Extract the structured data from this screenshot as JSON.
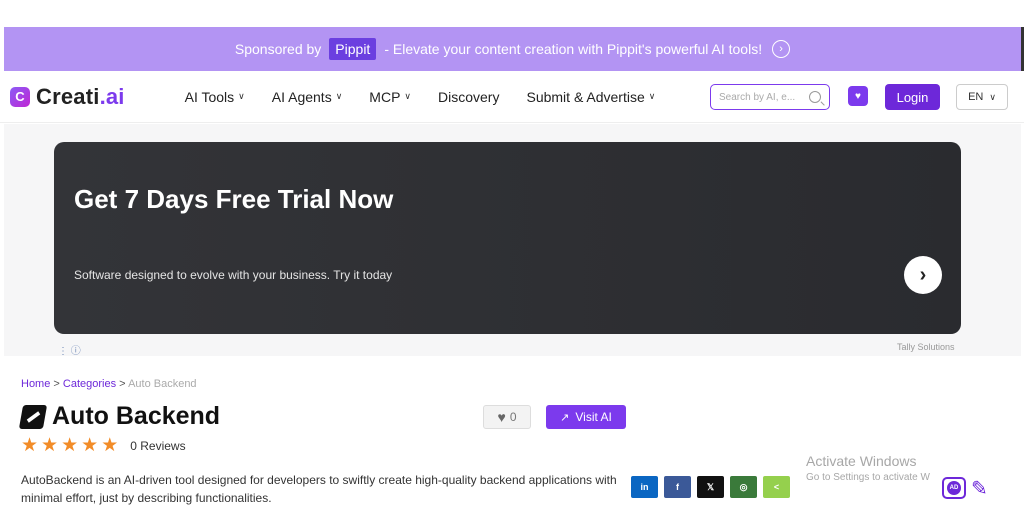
{
  "sponsor": {
    "prefix": "Sponsored by",
    "brand": "Pippit",
    "message": "- Elevate your content creation with Pippit's powerful AI tools!"
  },
  "nav": {
    "logo_main": "Creati",
    "logo_suffix": ".ai",
    "menu": [
      "AI Tools",
      "AI Agents",
      "MCP",
      "Discovery",
      "Submit & Advertise"
    ],
    "search_placeholder": "Search by AI, e...",
    "login": "Login",
    "lang": "EN"
  },
  "ad": {
    "headline": "Get 7 Days Free Trial Now",
    "sub": "Software designed to evolve with your business. Try it today",
    "source": "Tally Solutions"
  },
  "breadcrumb": {
    "home": "Home",
    "categories": "Categories",
    "current": "Auto Backend",
    "sep": ">"
  },
  "tool": {
    "title": "Auto Backend",
    "reviews": "0 Reviews",
    "likes": "0",
    "visit_label": "Visit AI",
    "description": "AutoBackend is an AI-driven tool designed for developers to swiftly create high-quality backend applications with minimal effort, just by describing functionalities.",
    "rating": 5
  },
  "shares": [
    {
      "name": "linkedin",
      "label": "in"
    },
    {
      "name": "facebook",
      "label": "f"
    },
    {
      "name": "x",
      "label": "𝕏"
    },
    {
      "name": "whatsapp",
      "label": "◎"
    },
    {
      "name": "share",
      "label": "<"
    }
  ],
  "watermark": {
    "line1": "Activate Windows",
    "line2": "Go to Settings to activate W"
  },
  "adbadge_label": "AD"
}
